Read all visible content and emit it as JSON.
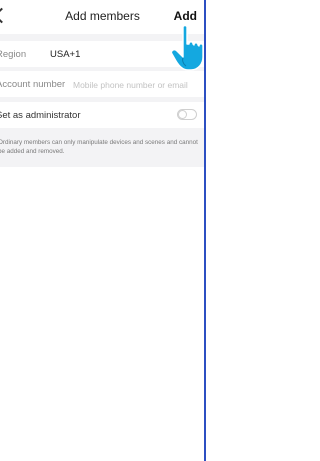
{
  "header": {
    "title": "Add members",
    "add_label": "Add"
  },
  "form": {
    "region": {
      "label": "Region",
      "value": "USA+1"
    },
    "account": {
      "label": "Account number",
      "placeholder": "Mobile phone number or email",
      "value": ""
    },
    "admin": {
      "label": "Set as administrator",
      "enabled": false
    },
    "note": "Ordinary members can only manipulate devices and scenes and cannot be added and removed."
  },
  "colors": {
    "pointer_blue": "#14a8e0",
    "frame_blue": "#2c4fc2"
  },
  "icons": [
    "back-chevron-icon",
    "hand-pointer-icon",
    "toggle-switch"
  ]
}
